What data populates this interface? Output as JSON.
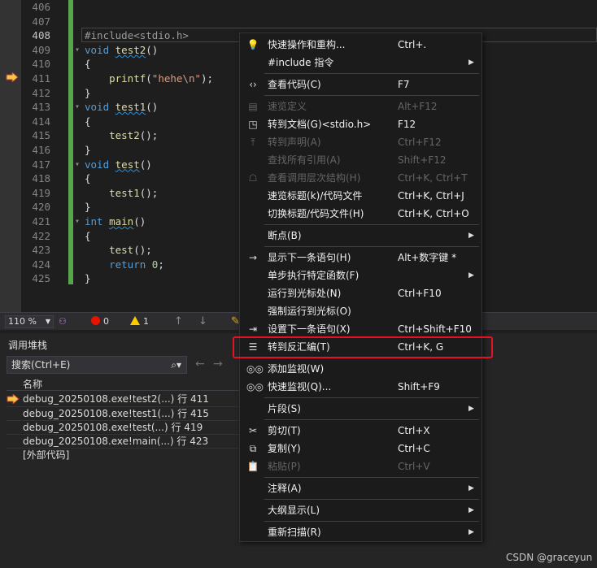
{
  "editor": {
    "lines": [
      {
        "no": "406",
        "parts": []
      },
      {
        "no": "407",
        "parts": []
      },
      {
        "no": "408",
        "parts": [
          {
            "t": "#include<stdio.h>",
            "c": "pre"
          }
        ]
      },
      {
        "no": "409",
        "parts": [
          {
            "t": "void",
            "c": "kw"
          },
          {
            "t": " ",
            "c": "plain"
          },
          {
            "t": "test2",
            "c": "fn-u"
          },
          {
            "t": "()",
            "c": "plain"
          }
        ]
      },
      {
        "no": "410",
        "parts": [
          {
            "t": "{",
            "c": "plain"
          }
        ]
      },
      {
        "no": "411",
        "parts": [
          {
            "t": "    ",
            "c": "plain"
          },
          {
            "t": "printf",
            "c": "fn"
          },
          {
            "t": "(",
            "c": "plain"
          },
          {
            "t": "\"hehe\\n\"",
            "c": "str"
          },
          {
            "t": ");",
            "c": "plain"
          }
        ]
      },
      {
        "no": "412",
        "parts": [
          {
            "t": "}",
            "c": "plain"
          }
        ]
      },
      {
        "no": "413",
        "parts": [
          {
            "t": "void",
            "c": "kw"
          },
          {
            "t": " ",
            "c": "plain"
          },
          {
            "t": "test1",
            "c": "fn-u"
          },
          {
            "t": "()",
            "c": "plain"
          }
        ]
      },
      {
        "no": "414",
        "parts": [
          {
            "t": "{",
            "c": "plain"
          }
        ]
      },
      {
        "no": "415",
        "parts": [
          {
            "t": "    ",
            "c": "plain"
          },
          {
            "t": "test2",
            "c": "fn"
          },
          {
            "t": "();",
            "c": "plain"
          }
        ]
      },
      {
        "no": "416",
        "parts": [
          {
            "t": "}",
            "c": "plain"
          }
        ]
      },
      {
        "no": "417",
        "parts": [
          {
            "t": "void",
            "c": "kw"
          },
          {
            "t": " ",
            "c": "plain"
          },
          {
            "t": "test",
            "c": "fn-u"
          },
          {
            "t": "()",
            "c": "plain"
          }
        ]
      },
      {
        "no": "418",
        "parts": [
          {
            "t": "{",
            "c": "plain"
          }
        ]
      },
      {
        "no": "419",
        "parts": [
          {
            "t": "    ",
            "c": "plain"
          },
          {
            "t": "test1",
            "c": "fn"
          },
          {
            "t": "();",
            "c": "plain"
          }
        ]
      },
      {
        "no": "420",
        "parts": [
          {
            "t": "}",
            "c": "plain"
          }
        ]
      },
      {
        "no": "421",
        "parts": [
          {
            "t": "int",
            "c": "kw"
          },
          {
            "t": " ",
            "c": "plain"
          },
          {
            "t": "main",
            "c": "fn-u"
          },
          {
            "t": "()",
            "c": "plain"
          }
        ]
      },
      {
        "no": "422",
        "parts": [
          {
            "t": "{",
            "c": "plain"
          }
        ]
      },
      {
        "no": "423",
        "parts": [
          {
            "t": "    ",
            "c": "plain"
          },
          {
            "t": "test",
            "c": "fn"
          },
          {
            "t": "();",
            "c": "plain"
          }
        ]
      },
      {
        "no": "424",
        "parts": [
          {
            "t": "    ",
            "c": "plain"
          },
          {
            "t": "return",
            "c": "kw"
          },
          {
            "t": " ",
            "c": "plain"
          },
          {
            "t": "0",
            "c": "num"
          },
          {
            "t": ";",
            "c": "plain"
          }
        ]
      },
      {
        "no": "425",
        "parts": [
          {
            "t": "}",
            "c": "plain"
          }
        ]
      }
    ]
  },
  "status_bar": {
    "zoom": "110 %",
    "errors": "0",
    "warnings": "1"
  },
  "call_stack": {
    "title": "调用堆栈",
    "search_placeholder": "搜索(Ctrl+E)",
    "column_name": "名称",
    "rows": [
      "debug_20250108.exe!test2(...) 行 411",
      "debug_20250108.exe!test1(...) 行 415",
      "debug_20250108.exe!test(...) 行 419",
      "debug_20250108.exe!main(...) 行 423",
      "[外部代码]"
    ]
  },
  "context_menu": {
    "items": [
      {
        "label": "快速操作和重构...",
        "shortcut": "Ctrl+.",
        "icon": "lightbulb-icon",
        "glyph": "💡",
        "enabled": true,
        "sub": false
      },
      {
        "label": "#include 指令",
        "shortcut": "",
        "icon": "",
        "glyph": "",
        "enabled": true,
        "sub": true
      },
      {
        "sep": true
      },
      {
        "label": "查看代码(C)",
        "shortcut": "F7",
        "icon": "code-icon",
        "glyph": "‹›",
        "enabled": true,
        "sub": false
      },
      {
        "sep": true
      },
      {
        "label": "速览定义",
        "shortcut": "Alt+F12",
        "icon": "peek-definition-icon",
        "glyph": "▤",
        "enabled": false,
        "sub": false
      },
      {
        "label": "转到文档(G)<stdio.h>",
        "shortcut": "F12",
        "icon": "go-to-document-icon",
        "glyph": "◳",
        "enabled": true,
        "sub": false
      },
      {
        "label": "转到声明(A)",
        "shortcut": "Ctrl+F12",
        "icon": "go-to-declaration-icon",
        "glyph": "⤒",
        "enabled": false,
        "sub": false
      },
      {
        "label": "查找所有引用(A)",
        "shortcut": "Shift+F12",
        "icon": "",
        "glyph": "",
        "enabled": false,
        "sub": false
      },
      {
        "label": "查看调用层次结构(H)",
        "shortcut": "Ctrl+K, Ctrl+T",
        "icon": "call-hierarchy-icon",
        "glyph": "☖",
        "enabled": false,
        "sub": false
      },
      {
        "label": "速览标题(k)/代码文件",
        "shortcut": "Ctrl+K, Ctrl+J",
        "icon": "",
        "glyph": "",
        "enabled": true,
        "sub": false
      },
      {
        "label": "切换标题/代码文件(H)",
        "shortcut": "Ctrl+K, Ctrl+O",
        "icon": "",
        "glyph": "",
        "enabled": true,
        "sub": false
      },
      {
        "sep": true
      },
      {
        "label": "断点(B)",
        "shortcut": "",
        "icon": "",
        "glyph": "",
        "enabled": true,
        "sub": true
      },
      {
        "sep": true
      },
      {
        "label": "显示下一条语句(H)",
        "shortcut": "Alt+数字键 *",
        "icon": "arrow-right-icon",
        "glyph": "→",
        "enabled": true,
        "sub": false
      },
      {
        "label": "单步执行特定函数(F)",
        "shortcut": "",
        "icon": "",
        "glyph": "",
        "enabled": true,
        "sub": true
      },
      {
        "label": "运行到光标处(N)",
        "shortcut": "Ctrl+F10",
        "icon": "",
        "glyph": "",
        "enabled": true,
        "sub": false
      },
      {
        "label": "强制运行到光标(O)",
        "shortcut": "",
        "icon": "",
        "glyph": "",
        "enabled": true,
        "sub": false
      },
      {
        "label": "设置下一条语句(X)",
        "shortcut": "Ctrl+Shift+F10",
        "icon": "set-next-statement-icon",
        "glyph": "⇥",
        "enabled": true,
        "sub": false
      },
      {
        "label": "转到反汇编(T)",
        "shortcut": "Ctrl+K, G",
        "icon": "disassembly-icon",
        "glyph": "☰",
        "enabled": true,
        "sub": false
      },
      {
        "sep": true
      },
      {
        "label": "添加监视(W)",
        "shortcut": "",
        "icon": "watch-glasses-icon",
        "glyph": "◎◎",
        "enabled": true,
        "sub": false
      },
      {
        "label": "快速监视(Q)...",
        "shortcut": "Shift+F9",
        "icon": "quick-watch-icon",
        "glyph": "◎◎",
        "enabled": true,
        "sub": false
      },
      {
        "sep": true
      },
      {
        "label": "片段(S)",
        "shortcut": "",
        "icon": "",
        "glyph": "",
        "enabled": true,
        "sub": true
      },
      {
        "sep": true
      },
      {
        "label": "剪切(T)",
        "shortcut": "Ctrl+X",
        "icon": "scissors-icon",
        "glyph": "✂",
        "enabled": true,
        "sub": false
      },
      {
        "label": "复制(Y)",
        "shortcut": "Ctrl+C",
        "icon": "copy-icon",
        "glyph": "⧉",
        "enabled": true,
        "sub": false
      },
      {
        "label": "粘贴(P)",
        "shortcut": "Ctrl+V",
        "icon": "paste-icon",
        "glyph": "📋",
        "enabled": false,
        "sub": false
      },
      {
        "sep": true
      },
      {
        "label": "注释(A)",
        "shortcut": "",
        "icon": "",
        "glyph": "",
        "enabled": true,
        "sub": true
      },
      {
        "sep": true
      },
      {
        "label": "大纲显示(L)",
        "shortcut": "",
        "icon": "",
        "glyph": "",
        "enabled": true,
        "sub": true
      },
      {
        "sep": true
      },
      {
        "label": "重新扫描(R)",
        "shortcut": "",
        "icon": "",
        "glyph": "",
        "enabled": true,
        "sub": true
      }
    ]
  },
  "watermark": "CSDN @graceyun",
  "colors": {
    "highlight_box": "#e81123",
    "keyword": "#569cd6",
    "function": "#dcdcaa",
    "string": "#d69d85",
    "green_bar": "#57a64a"
  }
}
